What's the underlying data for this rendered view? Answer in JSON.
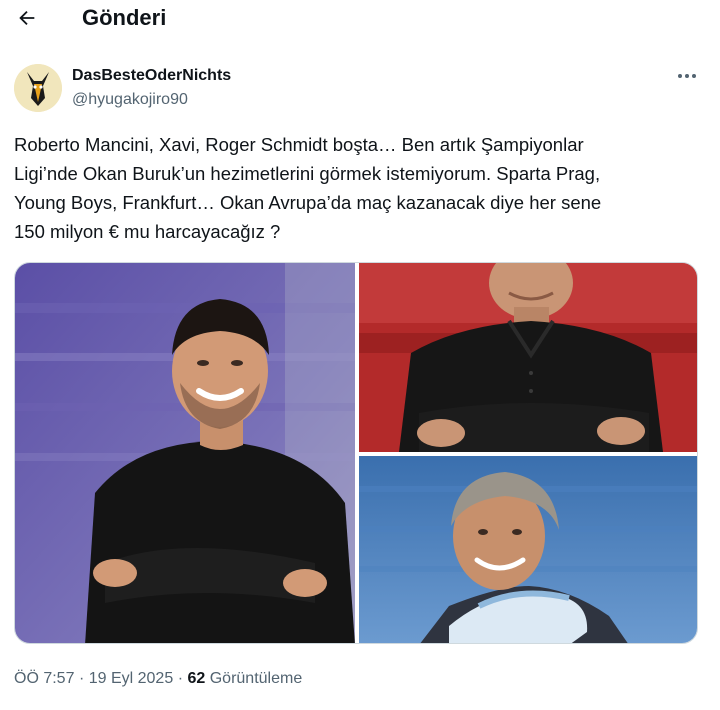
{
  "header": {
    "title": "Gönderi",
    "back_icon": "arrow-left-icon"
  },
  "author": {
    "name": "DasBesteOderNichts",
    "handle": "@hyugakojiro90",
    "more_icon": "more-horizontal-icon"
  },
  "tweet": {
    "text_lines": [
      "Roberto Mancini, Xavi, Roger Schmidt boşta… Ben artık Şampiyonlar",
      "Ligi’nde Okan Buruk’un hezimetlerini görmek istemiyorum. Sparta Prag,",
      "Young Boys, Frankfurt… Okan Avrupa’da maç kazanacak diye her sene",
      "150 milyon € mu harcayacağız ?"
    ]
  },
  "meta": {
    "time": "ÖÖ 7:57",
    "separator": "·",
    "date": "19 Eyl 2025",
    "views_count": "62",
    "views_label": "Görüntüleme"
  },
  "colors": {
    "text_primary": "#0f1419",
    "text_secondary": "#536471",
    "border": "#cfd9de"
  }
}
